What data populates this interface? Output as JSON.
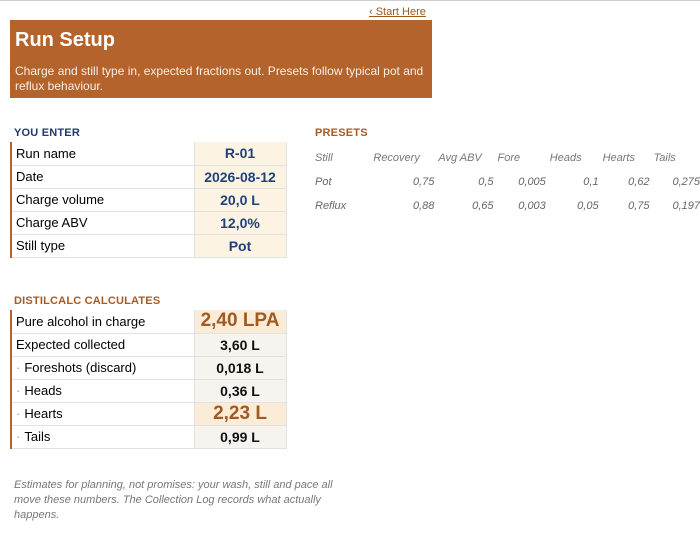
{
  "nav": {
    "start_link": "‹ Start Here"
  },
  "banner": {
    "title": "Run Setup",
    "subtitle": "Charge and still type in, expected fractions out. Presets follow typical pot and reflux behaviour."
  },
  "you_enter": {
    "title": "YOU ENTER",
    "rows": [
      {
        "label": "Run name",
        "value": "R-01"
      },
      {
        "label": "Date",
        "value": "2026-08-12"
      },
      {
        "label": "Charge volume",
        "value": "20,0 L"
      },
      {
        "label": "Charge ABV",
        "value": "12,0%"
      },
      {
        "label": "Still type",
        "value": "Pot"
      }
    ]
  },
  "calculates": {
    "title": "DISTILCALC CALCULATES",
    "rows": [
      {
        "label": "Pure alcohol in charge",
        "value": "2,40 LPA"
      },
      {
        "label": "Expected collected",
        "value": "3,60 L"
      },
      {
        "label": "Foreshots (discard)",
        "value": "0,018 L"
      },
      {
        "label": "Heads",
        "value": "0,36 L"
      },
      {
        "label": "Hearts",
        "value": "2,23 L"
      },
      {
        "label": "Tails",
        "value": "0,99 L"
      }
    ]
  },
  "presets": {
    "title": "PRESETS",
    "headers": [
      "Still",
      "Recovery",
      "Avg ABV",
      "Fore",
      "Heads",
      "Hearts",
      "Tails"
    ],
    "rows": [
      [
        "Pot",
        "0,75",
        "0,5",
        "0,005",
        "0,1",
        "0,62",
        "0,275"
      ],
      [
        "Reflux",
        "0,88",
        "0,65",
        "0,003",
        "0,05",
        "0,75",
        "0,197"
      ]
    ]
  },
  "footer": {
    "note": "Estimates for planning, not promises: your wash, still and pace all move these numbers. The Collection Log records what actually happens."
  },
  "colors": {
    "accent": "#b5632c",
    "input_value": "#20427a",
    "result_highlight": "#a05a22"
  }
}
